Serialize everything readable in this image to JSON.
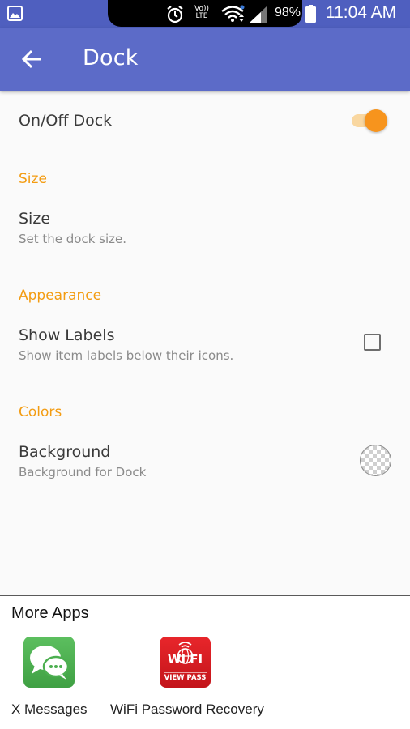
{
  "statusbar": {
    "volte_top": "Vo))",
    "volte_bottom": "LTE",
    "battery": "98%",
    "time": "11:04 AM"
  },
  "appbar": {
    "title": "Dock"
  },
  "settings": {
    "dock_toggle": {
      "label": "On/Off Dock",
      "enabled": true
    },
    "size_category": "Size",
    "size": {
      "title": "Size",
      "summary": "Set the dock size."
    },
    "appearance_category": "Appearance",
    "show_labels": {
      "title": "Show Labels",
      "summary": "Show item labels below their icons.",
      "checked": false
    },
    "colors_category": "Colors",
    "background": {
      "title": "Background",
      "summary": "Background for Dock"
    }
  },
  "more_apps": {
    "title": "More Apps",
    "apps": [
      {
        "name": "X Messages",
        "icon": "chat-bubbles-icon"
      },
      {
        "name": "WiFi Password Recovery",
        "icon": "wifi-view-pass-icon",
        "icon_text_top": "WI FI",
        "icon_text_bottom": "VIEW PASS"
      }
    ]
  },
  "colors": {
    "statusbar": "#4f5fbf",
    "appbar": "#5c6bc8",
    "accent": "#f7941d",
    "category_text": "#f39c12"
  }
}
